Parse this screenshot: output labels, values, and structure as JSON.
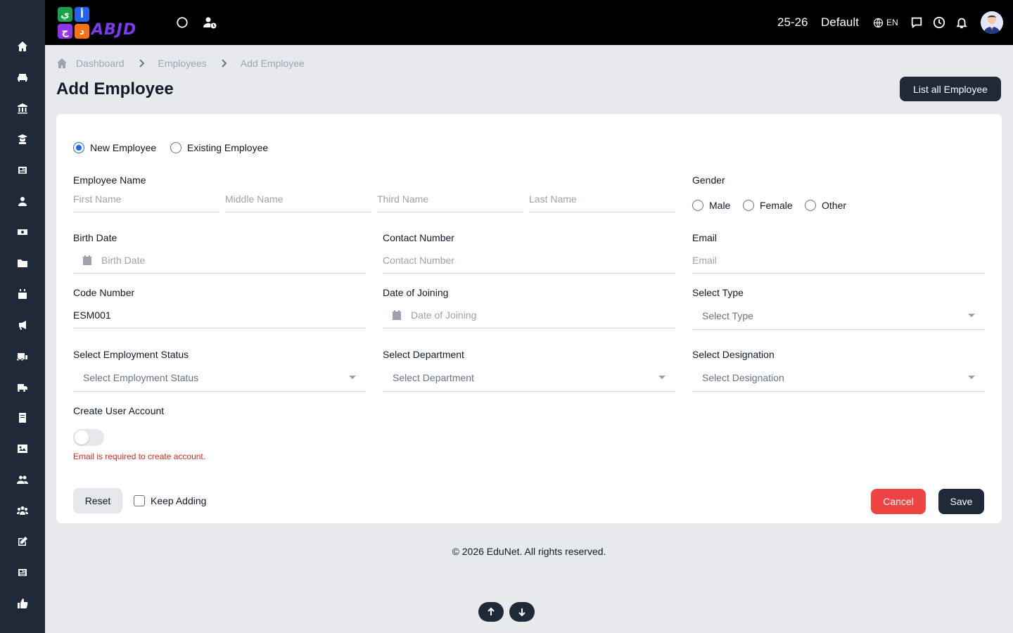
{
  "sidebar": {
    "items": [
      {
        "icon": "home-icon"
      },
      {
        "icon": "sofa-icon"
      },
      {
        "icon": "institution-icon"
      },
      {
        "icon": "graduate-icon"
      },
      {
        "icon": "newspaper-icon"
      },
      {
        "icon": "user-icon"
      },
      {
        "icon": "money-icon"
      },
      {
        "icon": "folder-icon"
      },
      {
        "icon": "calendar-icon"
      },
      {
        "icon": "megaphone-icon"
      },
      {
        "icon": "school-bus-icon"
      },
      {
        "icon": "truck-icon"
      },
      {
        "icon": "book-icon"
      },
      {
        "icon": "image-icon"
      },
      {
        "icon": "users-icon"
      },
      {
        "icon": "people-group-icon"
      },
      {
        "icon": "edit-icon"
      },
      {
        "icon": "news-icon"
      },
      {
        "icon": "thumbs-up-icon"
      }
    ]
  },
  "topbar": {
    "logo_text": "ABJD",
    "logo_letters": [
      "ي",
      "أ",
      "ج",
      "د"
    ],
    "year": "25-26",
    "profile": "Default",
    "language": "EN"
  },
  "breadcrumb": [
    "Dashboard",
    "Employees",
    "Add Employee"
  ],
  "page": {
    "title": "Add Employee",
    "list_button": "List all Employee"
  },
  "form": {
    "mode_options": [
      {
        "label": "New Employee",
        "checked": true
      },
      {
        "label": "Existing Employee",
        "checked": false
      }
    ],
    "employee_name_label": "Employee Name",
    "name_placeholders": [
      "First Name",
      "Middle Name",
      "Third Name",
      "Last Name"
    ],
    "gender_label": "Gender",
    "gender_options": [
      "Male",
      "Female",
      "Other"
    ],
    "birth_date_label": "Birth Date",
    "birth_date_placeholder": "Birth Date",
    "contact_label": "Contact Number",
    "contact_placeholder": "Contact Number",
    "email_label": "Email",
    "email_placeholder": "Email",
    "code_label": "Code Number",
    "code_value": "ESM001",
    "joining_label": "Date of Joining",
    "joining_placeholder": "Date of Joining",
    "type_label": "Select Type",
    "type_value": "Select Type",
    "employment_status_label": "Select Employment Status",
    "employment_status_value": "Select Employment Status",
    "department_label": "Select Department",
    "department_value": "Select Department",
    "designation_label": "Select Designation",
    "designation_value": "Select Designation",
    "user_account_label": "Create User Account",
    "user_account_enabled": false,
    "error_text": "Email is required to create account.",
    "reset_label": "Reset",
    "keep_adding_label": "Keep Adding",
    "cancel_label": "Cancel",
    "save_label": "Save"
  },
  "footer": {
    "text": "© 2026 EduNet. All rights reserved."
  },
  "colors": {
    "primary": "#1f2937",
    "danger": "#ef4444",
    "radio_accent": "#2563eb",
    "error": "#dc2626"
  }
}
